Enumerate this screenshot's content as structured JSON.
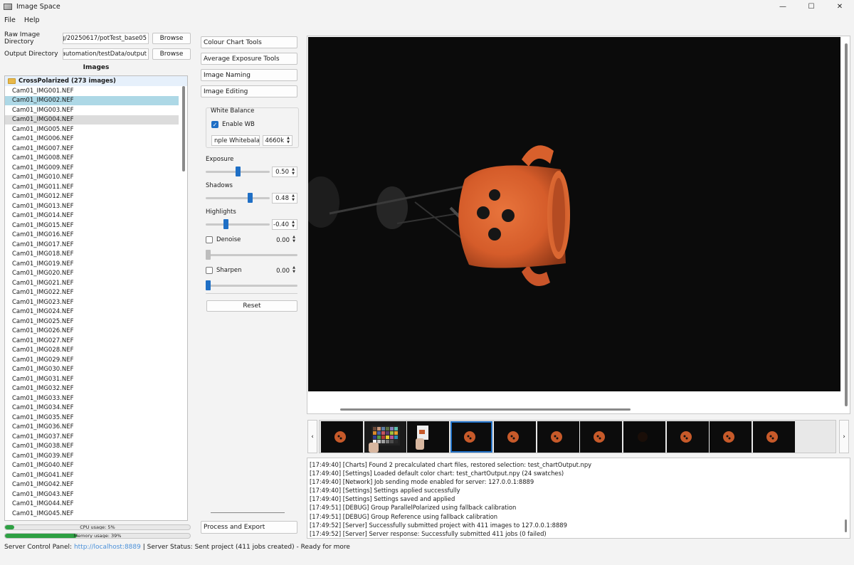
{
  "window": {
    "title": "Image Space"
  },
  "menu": [
    "File",
    "Help"
  ],
  "dirs": {
    "raw_label": "Raw Image Directory",
    "raw_value": "g/20250617/potTest_base05",
    "output_label": "Output Directory",
    "output_value": "e/automation/testData/output",
    "browse_label": "Browse"
  },
  "images": {
    "heading": "Images",
    "folder": "CrossPolarized (273 images)",
    "files": [
      "Cam01_IMG001.NEF",
      "Cam01_IMG002.NEF",
      "Cam01_IMG003.NEF",
      "Cam01_IMG004.NEF",
      "Cam01_IMG005.NEF",
      "Cam01_IMG006.NEF",
      "Cam01_IMG007.NEF",
      "Cam01_IMG008.NEF",
      "Cam01_IMG009.NEF",
      "Cam01_IMG010.NEF",
      "Cam01_IMG011.NEF",
      "Cam01_IMG012.NEF",
      "Cam01_IMG013.NEF",
      "Cam01_IMG014.NEF",
      "Cam01_IMG015.NEF",
      "Cam01_IMG016.NEF",
      "Cam01_IMG017.NEF",
      "Cam01_IMG018.NEF",
      "Cam01_IMG019.NEF",
      "Cam01_IMG020.NEF",
      "Cam01_IMG021.NEF",
      "Cam01_IMG022.NEF",
      "Cam01_IMG023.NEF",
      "Cam01_IMG024.NEF",
      "Cam01_IMG025.NEF",
      "Cam01_IMG026.NEF",
      "Cam01_IMG027.NEF",
      "Cam01_IMG028.NEF",
      "Cam01_IMG029.NEF",
      "Cam01_IMG030.NEF",
      "Cam01_IMG031.NEF",
      "Cam01_IMG032.NEF",
      "Cam01_IMG033.NEF",
      "Cam01_IMG034.NEF",
      "Cam01_IMG035.NEF",
      "Cam01_IMG036.NEF",
      "Cam01_IMG037.NEF",
      "Cam01_IMG038.NEF",
      "Cam01_IMG039.NEF",
      "Cam01_IMG040.NEF",
      "Cam01_IMG041.NEF",
      "Cam01_IMG042.NEF",
      "Cam01_IMG043.NEF",
      "Cam01_IMG044.NEF",
      "Cam01_IMG045.NEF"
    ],
    "selected_index": 1,
    "hover_index": 3
  },
  "usage": {
    "cpu_label": "CPU usage: 5%",
    "cpu_fraction": 0.05,
    "memory_label": "Memory usage: 39%",
    "memory_fraction": 0.39,
    "bar_color": "#2ea043"
  },
  "status": {
    "prefix": "Server Control Panel: ",
    "link": "http://localhost:8889",
    "suffix": " | Server Status: Sent project (411 jobs created) - Ready for more"
  },
  "tools": [
    "Colour Chart Tools",
    "Average Exposure Tools",
    "Image Naming",
    "Image Editing"
  ],
  "editing": {
    "wb_group": "White Balance",
    "enable_wb": "Enable WB",
    "enable_wb_checked": true,
    "wb_mode": "nple Whitebalar",
    "wb_temp": "4660k",
    "exposure_label": "Exposure",
    "exposure_value": "0.50",
    "exposure_pos": 0.5,
    "shadows_label": "Shadows",
    "shadows_value": "0.48",
    "shadows_pos": 0.71,
    "highlights_label": "Highlights",
    "highlights_value": "-0.40",
    "highlights_pos": 0.3,
    "denoise_label": "Denoise",
    "denoise_value": "0.00",
    "denoise_pos": 0.0,
    "sharpen_label": "Sharpen",
    "sharpen_value": "0.00",
    "sharpen_pos": 0.0,
    "reset_label": "Reset",
    "accent": "#1f6fc5"
  },
  "process_label": "Process and Export",
  "thumbnails": {
    "count": 11,
    "selected_index": 3,
    "kinds": [
      "pot",
      "chart",
      "card",
      "pot",
      "pot",
      "pot",
      "pot",
      "dark",
      "pot",
      "pot",
      "pot"
    ]
  },
  "log": [
    "[17:49:40] [Charts] Found 2 precalculated chart files, restored selection: test_chartOutput.npy",
    "[17:49:40] [Settings] Loaded default color chart: test_chartOutput.npy (24 swatches)",
    "[17:49:40] [Network] Job sending mode enabled for server: 127.0.0.1:8889",
    "[17:49:40] [Settings] Settings applied successfully",
    "[17:49:40] [Settings] Settings saved and applied",
    "[17:49:51] [DEBUG] Group ParallelPolarized using fallback calibration",
    "[17:49:51] [DEBUG] Group Reference using fallback calibration",
    "[17:49:52] [Server] Successfully submitted project with 411 images to 127.0.0.1:8889",
    "[17:49:52] [Server] Server response: Successfully submitted 411 jobs (0 failed)"
  ]
}
